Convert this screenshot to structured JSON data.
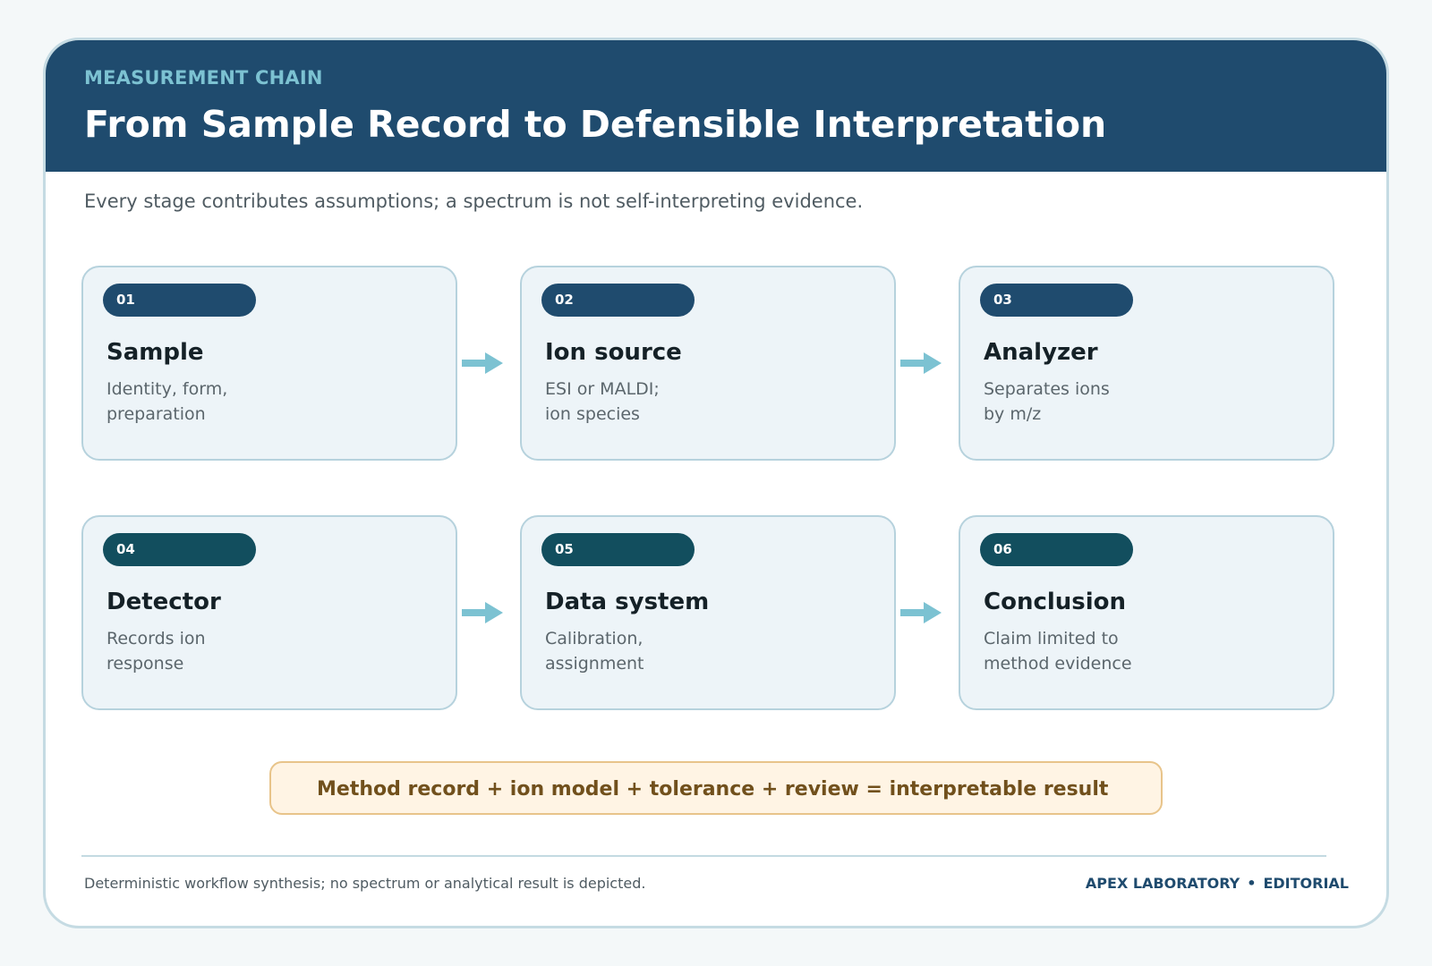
{
  "header": {
    "eyebrow": "MEASUREMENT CHAIN",
    "title": "From Sample Record to Defensible Interpretation"
  },
  "subtitle": "Every stage contributes assumptions; a spectrum is not self-interpreting evidence.",
  "stages": [
    {
      "number": "01",
      "title": "Sample",
      "desc": [
        "Identity, form,",
        "preparation"
      ]
    },
    {
      "number": "02",
      "title": "Ion source",
      "desc": [
        "ESI or MALDI;",
        "ion species"
      ]
    },
    {
      "number": "03",
      "title": "Analyzer",
      "desc": [
        "Separates ions",
        "by m/z"
      ]
    },
    {
      "number": "04",
      "title": "Detector",
      "desc": [
        "Records ion",
        "response"
      ]
    },
    {
      "number": "05",
      "title": "Data system",
      "desc": [
        "Calibration,",
        "assignment"
      ]
    },
    {
      "number": "06",
      "title": "Conclusion",
      "desc": [
        "Claim limited to",
        "method evidence"
      ]
    }
  ],
  "formula": "Method record + ion model + tolerance + review = interpretable result",
  "footer": {
    "note": "Deterministic workflow synthesis; no spectrum or analytical result is depicted.",
    "brand": "APEX LABORATORY",
    "separator": "•",
    "section": "EDITORIAL"
  },
  "colors": {
    "header_bg": "#1f4b6e",
    "eyebrow": "#7cc2d2",
    "pill_row1": "#1f4b6e",
    "pill_row2": "#124e5e",
    "arrow": "#7cc2d2",
    "formula_bg": "#fff4e4",
    "formula_text": "#71501c"
  },
  "icons": {
    "connector": "right-arrow-icon"
  }
}
